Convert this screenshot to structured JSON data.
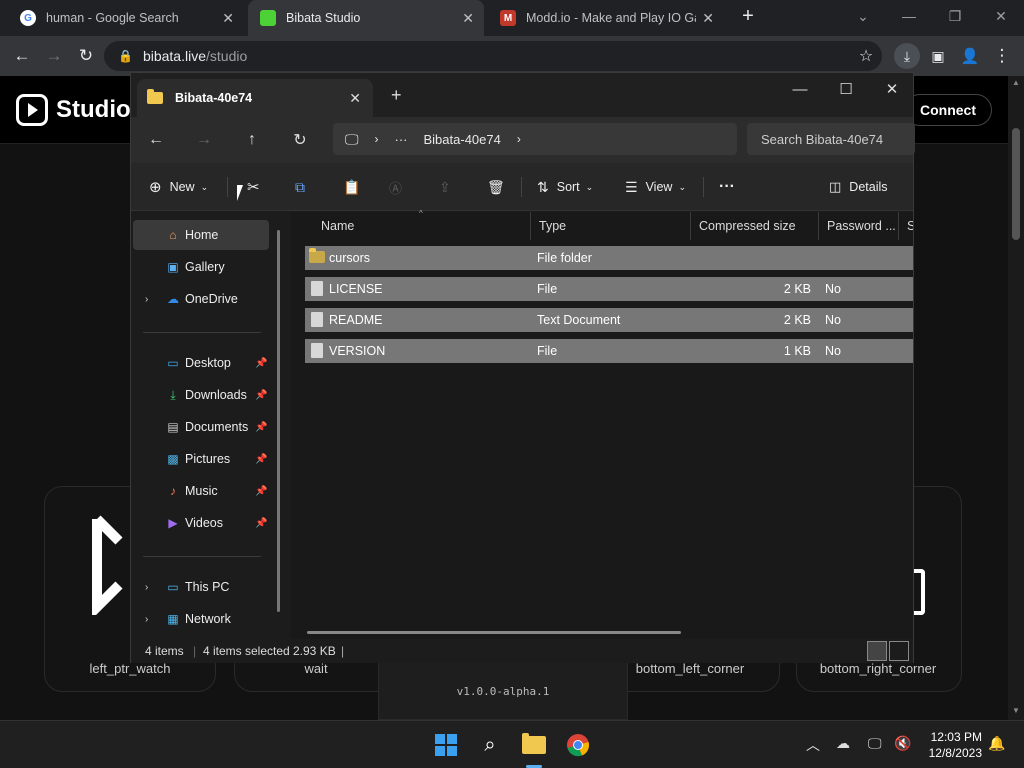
{
  "browser": {
    "tabs": [
      {
        "title": "human - Google Search",
        "favicon": "google-icon"
      },
      {
        "title": "Bibata Studio",
        "favicon": "bibata-icon"
      },
      {
        "title": "Modd.io - Make and Play IO Gan",
        "favicon": "moddio-icon"
      }
    ],
    "url_host": "bibata.live",
    "url_path": "/studio"
  },
  "studio": {
    "title": "Studio",
    "connect_label": "Connect",
    "cursor_labels": [
      "left_ptr_watch",
      "wait",
      "bottom_left_corner",
      "bottom_right_corner"
    ],
    "version": "v1.0.0-alpha.1"
  },
  "explorer": {
    "tab_title": "Bibata-40e74",
    "breadcrumb": "Bibata-40e74",
    "breadcrumb_more": "···",
    "search_placeholder": "Search Bibata-40e74",
    "commands": {
      "new": "New",
      "sort": "Sort",
      "view": "View",
      "details": "Details",
      "more": "···"
    },
    "nav": [
      {
        "label": "Home",
        "icon": "home-icon"
      },
      {
        "label": "Gallery",
        "icon": "gallery-icon"
      },
      {
        "label": "OneDrive",
        "icon": "onedrive-icon"
      },
      {
        "label": "Desktop",
        "icon": "desktop-icon"
      },
      {
        "label": "Downloads",
        "icon": "download-icon"
      },
      {
        "label": "Documents",
        "icon": "documents-icon"
      },
      {
        "label": "Pictures",
        "icon": "pictures-icon"
      },
      {
        "label": "Music",
        "icon": "music-icon"
      },
      {
        "label": "Videos",
        "icon": "videos-icon"
      },
      {
        "label": "This PC",
        "icon": "pc-icon"
      },
      {
        "label": "Network",
        "icon": "network-icon"
      }
    ],
    "columns": [
      "Name",
      "Type",
      "Compressed size",
      "Password ...",
      "Si"
    ],
    "rows": [
      {
        "name": "cursors",
        "type": "File folder",
        "size": "",
        "password": ""
      },
      {
        "name": "LICENSE",
        "type": "File",
        "size": "2 KB",
        "password": "No"
      },
      {
        "name": "README",
        "type": "Text Document",
        "size": "2 KB",
        "password": "No"
      },
      {
        "name": "VERSION",
        "type": "File",
        "size": "1 KB",
        "password": "No"
      }
    ],
    "status": {
      "count": "4 items",
      "selected": "4 items selected",
      "size": "2.93 KB"
    }
  },
  "taskbar": {
    "time": "12:03 PM",
    "date": "12/8/2023"
  }
}
